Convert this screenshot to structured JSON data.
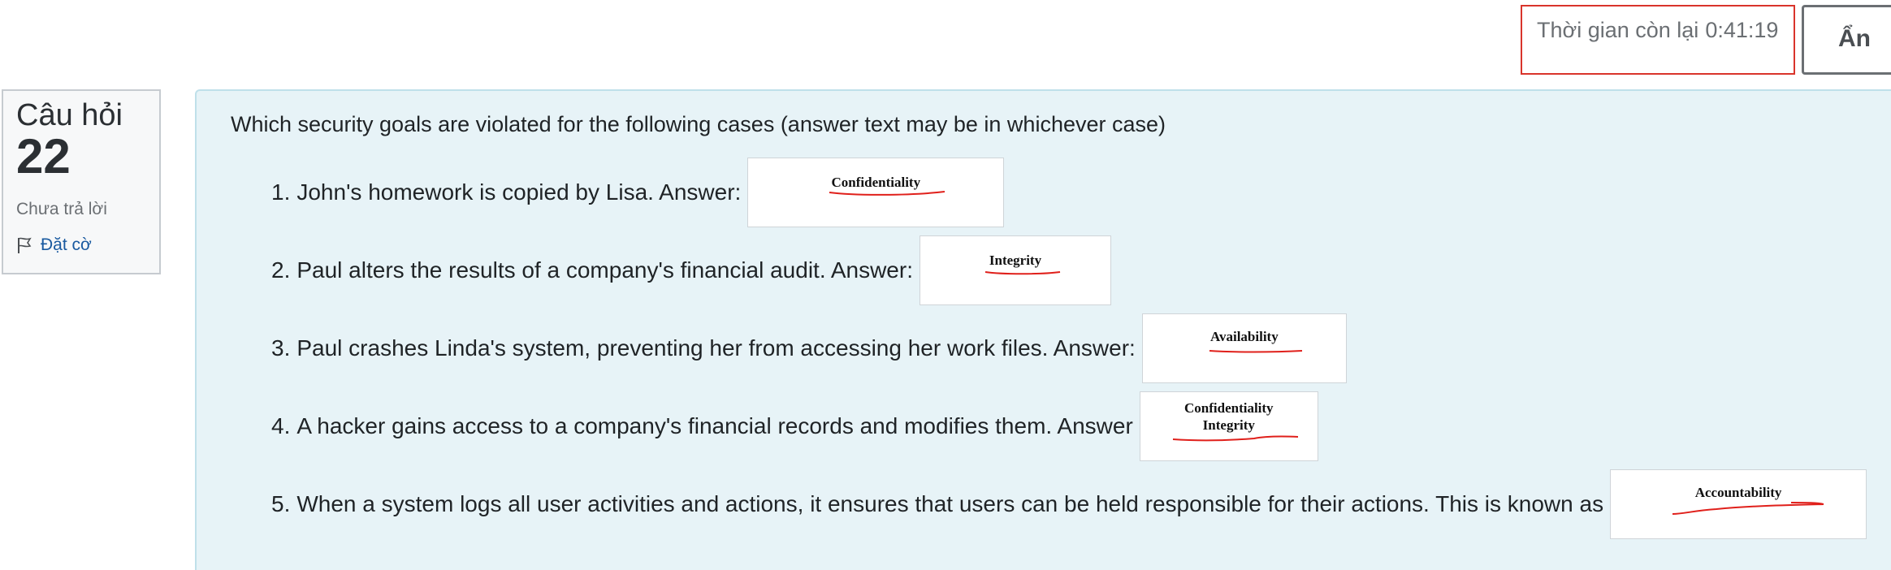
{
  "timer": {
    "label": "Thời gian còn lại",
    "value": "0:41:19"
  },
  "hide_button": {
    "label": "Ẩn"
  },
  "question_info": {
    "label": "Câu hỏi",
    "number": "22",
    "status": "Chưa trả lời",
    "flag_label": "Đặt cờ"
  },
  "question": {
    "prompt": "Which security goals are violated for the following cases (answer text may be in whichever case)",
    "items": [
      {
        "num": "1.",
        "text": "John's homework is copied by Lisa. Answer:",
        "answer_lines": [
          "Confidentiality"
        ]
      },
      {
        "num": "2.",
        "text": "Paul alters the results of a company's financial audit. Answer:",
        "answer_lines": [
          "Integrity"
        ]
      },
      {
        "num": "3.",
        "text": "Paul crashes Linda's system, preventing her from accessing her work files. Answer:",
        "answer_lines": [
          "Availability"
        ]
      },
      {
        "num": "4.",
        "text": "A hacker gains access to a company's financial records and modifies them. Answer",
        "answer_lines": [
          "Confidentiality",
          "Integrity"
        ]
      },
      {
        "num": "5.",
        "text": "When a system logs all user activities and actions, it ensures that users can be held responsible for their actions. This is known as",
        "answer_lines": [
          "Accountability"
        ]
      }
    ]
  },
  "colors": {
    "timer_border": "#d9342b",
    "panel_bg": "#e7f3f7",
    "link": "#1a5aa0",
    "annotation_red": "#e0201b"
  },
  "icons": {
    "flag": "flag-icon"
  }
}
